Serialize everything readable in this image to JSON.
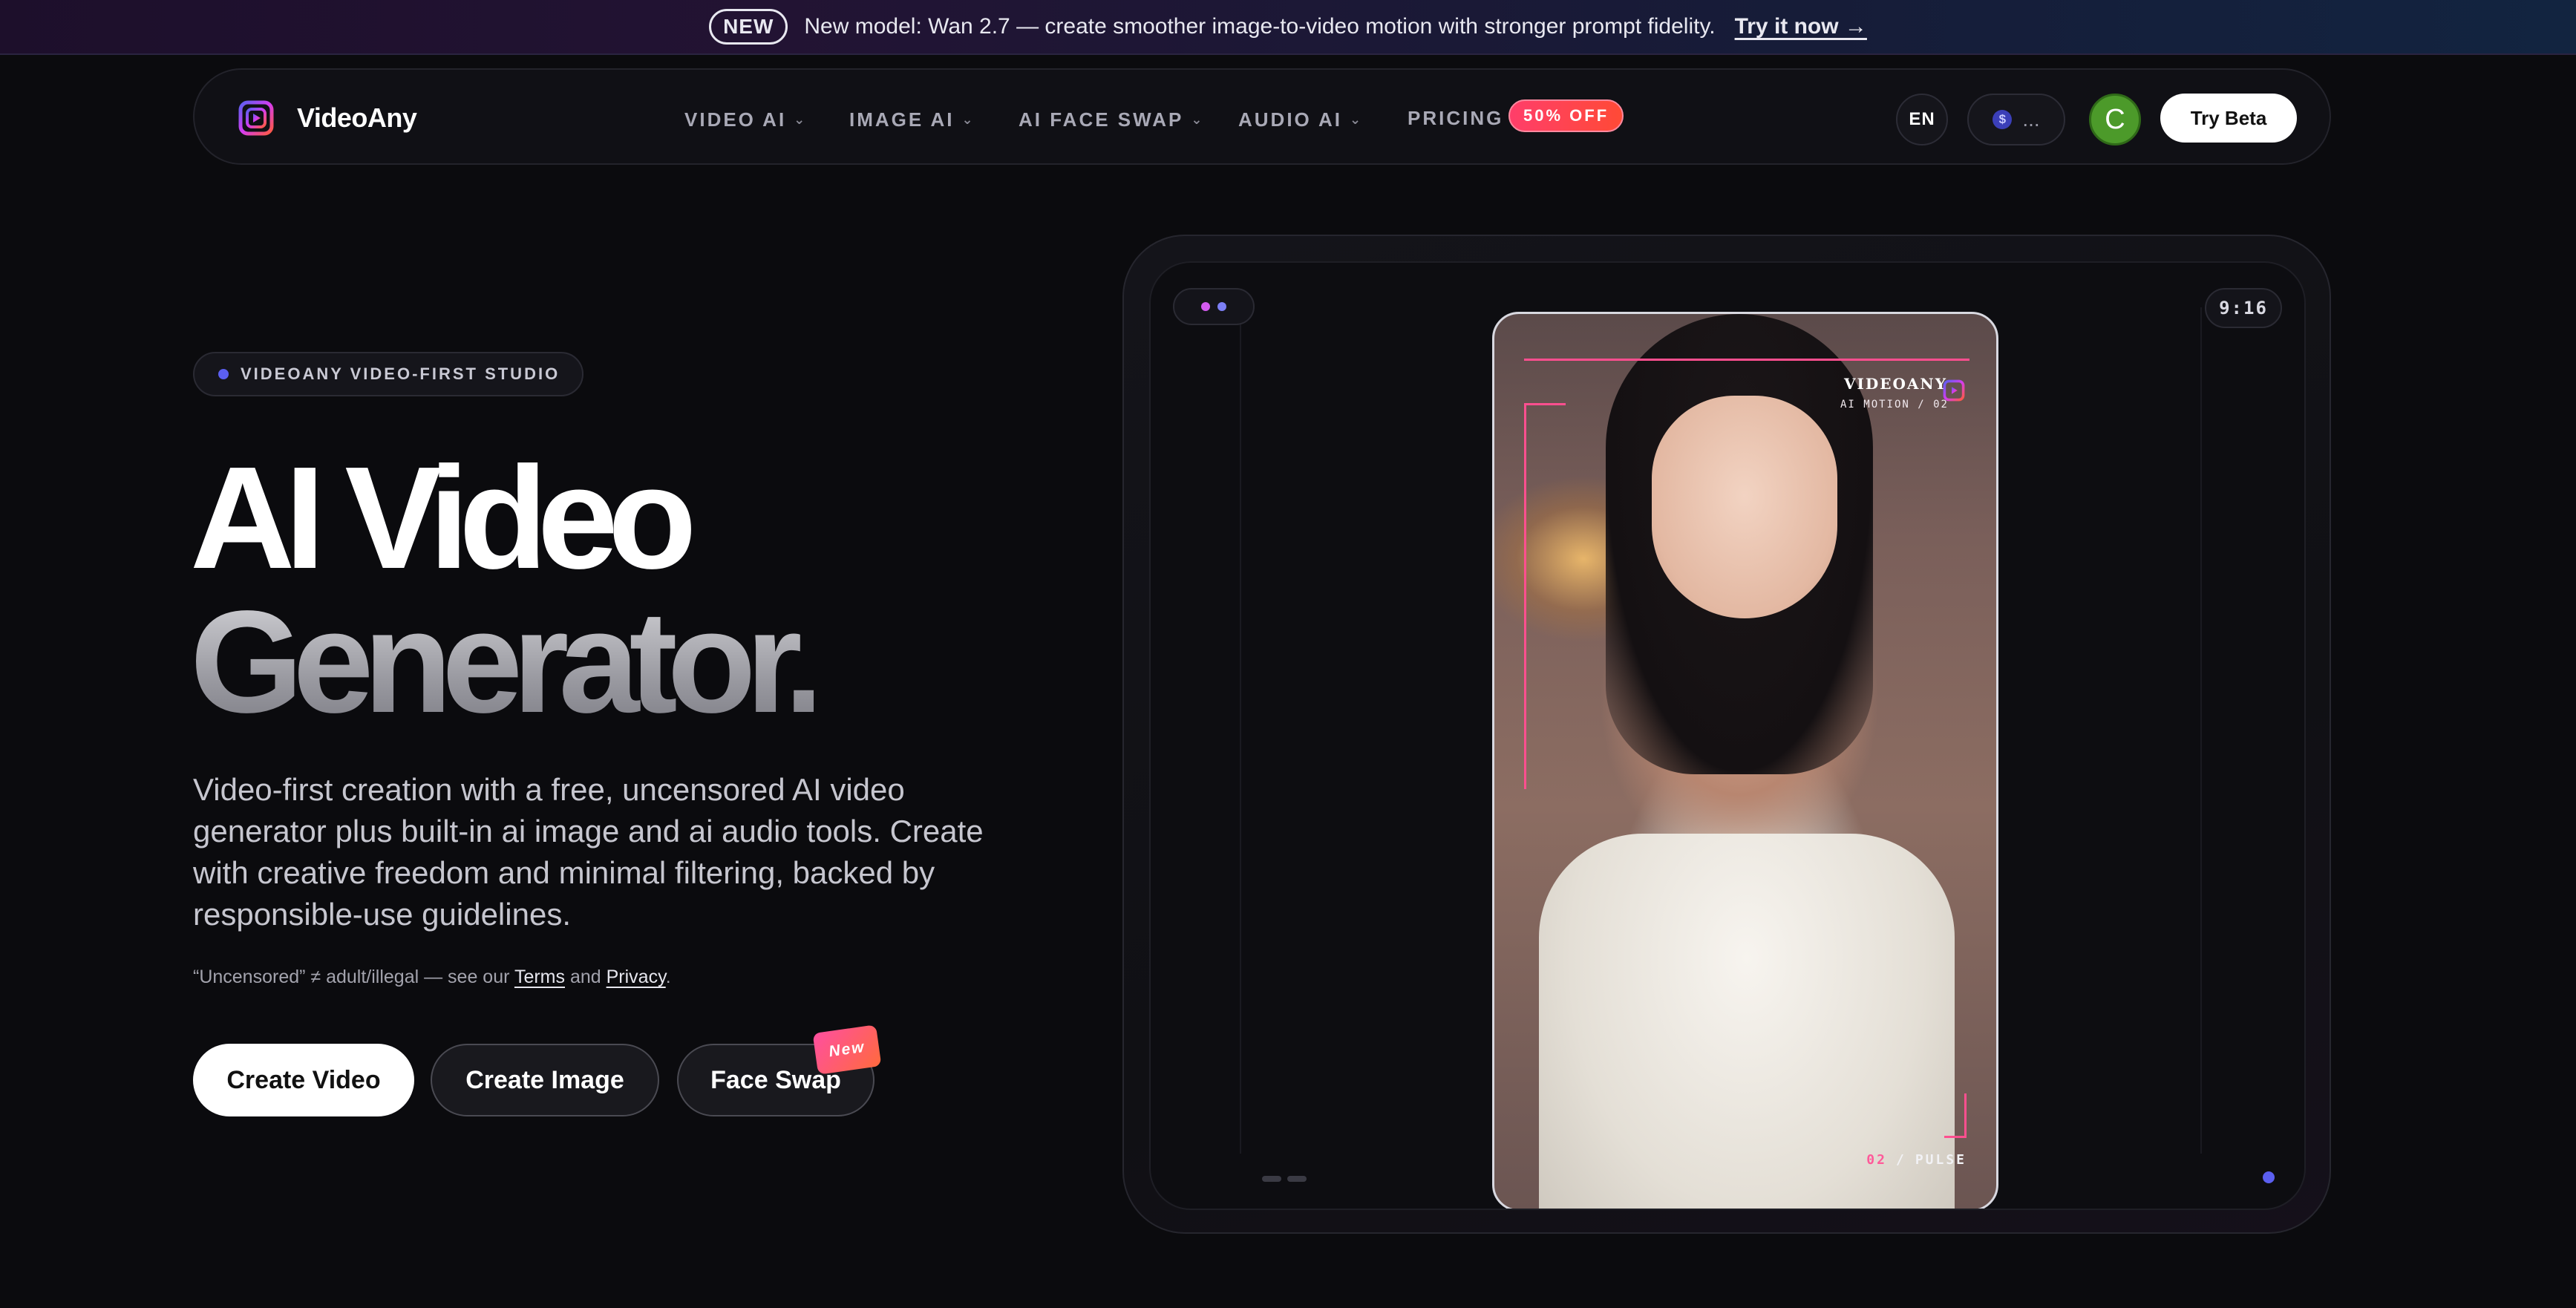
{
  "announcement": {
    "badge": "NEW",
    "text": "New model: Wan 2.7 — create smoother image-to-video motion with stronger prompt fidelity.",
    "link": "Try it now →"
  },
  "nav": {
    "brand": "VideoAny",
    "items": [
      {
        "label": "VIDEO AI"
      },
      {
        "label": "IMAGE AI"
      },
      {
        "label": "AI FACE SWAP"
      },
      {
        "label": "AUDIO AI"
      }
    ],
    "pricing": "PRICING",
    "pricing_badge": "50% OFF",
    "language": "EN",
    "credits_icon": "$",
    "credits_value": "...",
    "avatar_initial": "C",
    "try_beta": "Try Beta"
  },
  "hero": {
    "eyebrow": "VIDEOANY VIDEO-FIRST STUDIO",
    "title_line1": "AI Video",
    "title_line2": "Generator.",
    "description": "Video-first creation with a free, uncensored AI video generator plus built-in ai image and ai audio tools. Create with creative freedom and minimal filtering, backed by responsible-use guidelines.",
    "fineprint": {
      "prefix": "“Uncensored” ≠ adult/illegal — see our ",
      "terms": "Terms",
      "and": " and ",
      "privacy": "Privacy",
      "suffix": "."
    },
    "buttons": {
      "create_video": "Create Video",
      "create_image": "Create Image",
      "face_swap": "Face Swap",
      "face_swap_badge": "New"
    }
  },
  "preview": {
    "ratio": "9:16",
    "overlay_brand": "VIDEOANY",
    "overlay_sub": "AI MOTION / 02",
    "overlay_num": "02",
    "overlay_sep": "/",
    "overlay_label": "PULSE"
  },
  "colors": {
    "accent": "#5b5ff0",
    "hud_pink": "#ff4f8f",
    "badge_red": "#ff3e6a",
    "avatar_green": "#4c9a2a"
  }
}
